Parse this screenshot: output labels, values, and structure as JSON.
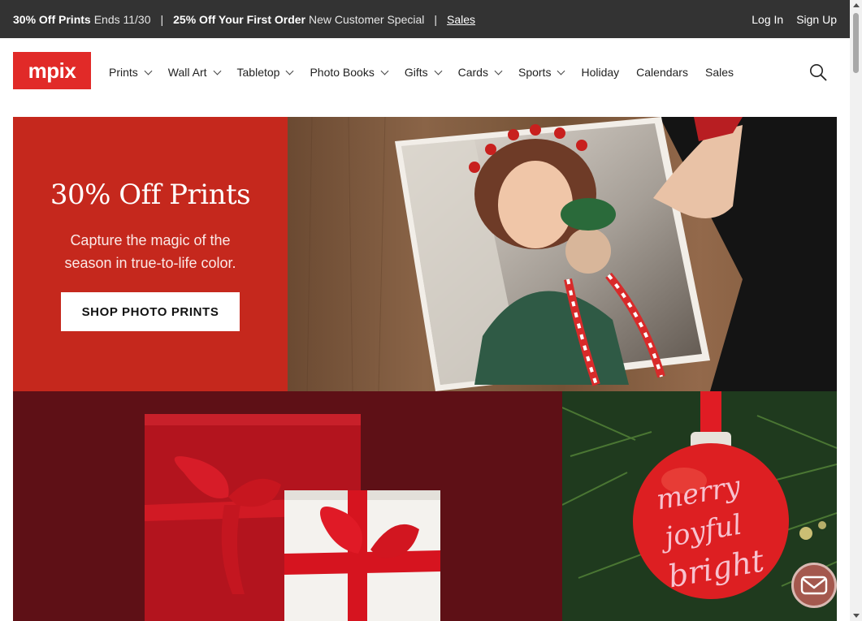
{
  "promo": {
    "offer1_bold": "30% Off Prints",
    "offer1_detail": "Ends 11/30",
    "separator": "|",
    "offer2_bold": "25% Off Your First Order",
    "offer2_detail": "New Customer Special",
    "sales_link": "Sales",
    "login": "Log In",
    "signup": "Sign Up"
  },
  "brand": {
    "logo_text": "mpix",
    "logo_color": "#e12a28"
  },
  "nav": {
    "prints": "Prints",
    "wall_art": "Wall Art",
    "tabletop": "Tabletop",
    "photo_books": "Photo Books",
    "gifts": "Gifts",
    "cards": "Cards",
    "sports": "Sports",
    "holiday": "Holiday",
    "calendars": "Calendars",
    "sales": "Sales",
    "search_icon": "search-icon"
  },
  "hero": {
    "title": "30% Off Prints",
    "subtitle": "Capture the magic of the season in true-to-life color.",
    "cta": "SHOP PHOTO PRINTS",
    "panel_color": "#c5281d"
  },
  "ornament": {
    "line1": "merry",
    "line2": "joyful",
    "line3": "bright"
  },
  "chat": {
    "icon": "envelope-icon"
  }
}
